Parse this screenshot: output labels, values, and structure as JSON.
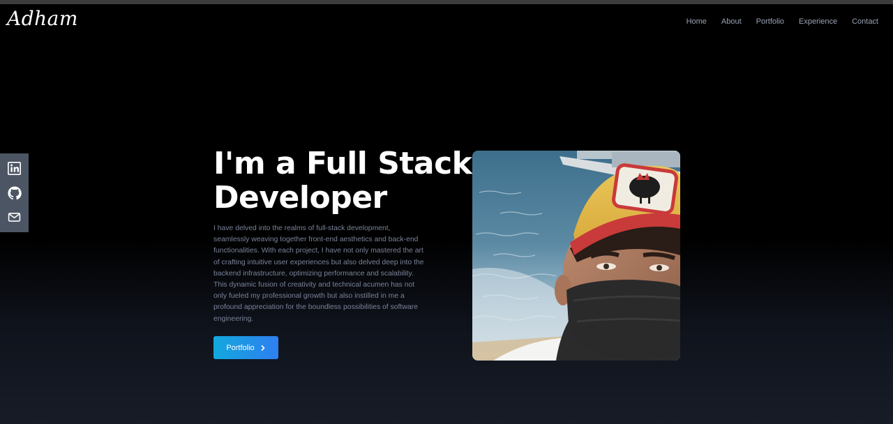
{
  "brand": {
    "logo_text": "Adham"
  },
  "nav": {
    "items": [
      {
        "label": "Home"
      },
      {
        "label": "About"
      },
      {
        "label": "Portfolio"
      },
      {
        "label": "Experience"
      },
      {
        "label": "Contact"
      }
    ]
  },
  "social": {
    "icons": [
      "linkedin-icon",
      "github-icon",
      "mail-icon"
    ]
  },
  "hero": {
    "title": "I'm a Full Stack Developer",
    "description": "I have delved into the realms of full-stack development, seamlessly weaving together front-end aesthetics and back-end functionalities. With each project, I have not only mastered the art of crafting intuitive user experiences but also delved deep into the backend infrastructure, optimizing performance and scalability. This dynamic fusion of creativity and technical acumen has not only fueled my professional growth but also instilled in me a profound appreciation for the boundless possibilities of software engineering.",
    "cta_label": "Portfolio",
    "cta_icon": "chevron-right-icon"
  },
  "colors": {
    "accent_start": "#12a8dd",
    "accent_end": "#2f7ff0",
    "nav_text": "#9aa3b5",
    "body_text": "#7a8399",
    "sidebar_bg": "#4c5563"
  }
}
